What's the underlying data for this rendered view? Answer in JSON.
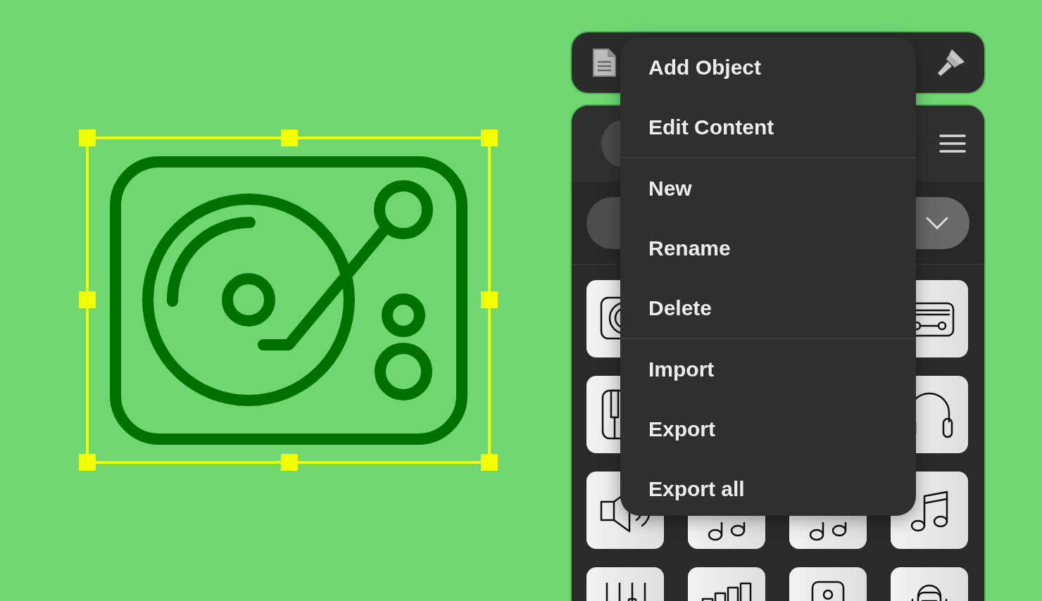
{
  "menu": {
    "groups": [
      {
        "items": [
          "Add Object",
          "Edit Content"
        ]
      },
      {
        "items": [
          "New",
          "Rename",
          "Delete"
        ]
      },
      {
        "items": [
          "Import",
          "Export",
          "Export all"
        ]
      }
    ]
  }
}
